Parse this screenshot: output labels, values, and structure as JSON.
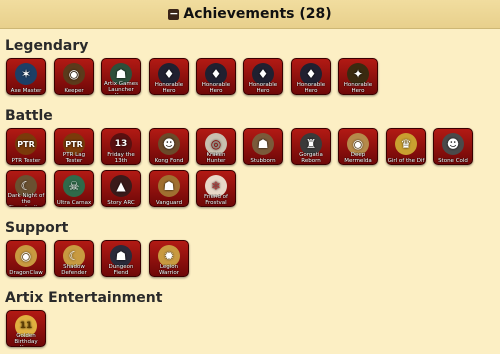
{
  "header": {
    "toggle": "−",
    "title": "Achievements (28)"
  },
  "sections": {
    "legendary": {
      "title": "Legendary"
    },
    "battle": {
      "title": "Battle"
    },
    "support": {
      "title": "Support"
    },
    "artix": {
      "title": "Artix Entertainment"
    }
  },
  "badges": {
    "b1": {
      "label": "Axe Master",
      "glyph": "✶"
    },
    "b2": {
      "label": "Keeper",
      "glyph": "◉"
    },
    "b3": {
      "label": "Artix Games Launcher Hero",
      "glyph": "☗"
    },
    "b4": {
      "label": "Honorable Hero",
      "glyph": "♦"
    },
    "b5": {
      "label": "Honorable Hero",
      "glyph": "♦"
    },
    "b6": {
      "label": "Honorable Hero",
      "glyph": "♦"
    },
    "b7": {
      "label": "Honorable Hero",
      "glyph": "♦"
    },
    "b8": {
      "label": "Honorable Hero",
      "glyph": "✦"
    },
    "b9": {
      "label": "PTR Tester",
      "glyph": "PTR"
    },
    "b10": {
      "label": "PTR Lag Tester",
      "glyph": "PTR"
    },
    "b11": {
      "label": "Friday the 13th",
      "glyph": "13"
    },
    "b12": {
      "label": "Kong Fond",
      "glyph": "☻"
    },
    "b13": {
      "label": "Kraken Hunter",
      "glyph": "◎"
    },
    "b14": {
      "label": "Stubborn",
      "glyph": "☗"
    },
    "b15": {
      "label": "Gorgatia Reborn",
      "glyph": "♜"
    },
    "b16": {
      "label": "Deep Mermelda",
      "glyph": "◉"
    },
    "b17": {
      "label": "Girl of the Dif",
      "glyph": "♛"
    },
    "b18": {
      "label": "Stone Cold",
      "glyph": "☻"
    },
    "b19": {
      "label": "Dark Night of the Disembodied",
      "glyph": "☾"
    },
    "b20": {
      "label": "Ultra Carnax",
      "glyph": "☠"
    },
    "b21": {
      "label": "Story ARC",
      "glyph": "▲"
    },
    "b22": {
      "label": "Vanguard",
      "glyph": "☗"
    },
    "b23": {
      "label": "Friend of Frostval",
      "glyph": "❄"
    },
    "b24": {
      "label": "DragonClaw",
      "glyph": "◉"
    },
    "b25": {
      "label": "Shadow Defender",
      "glyph": "☾"
    },
    "b26": {
      "label": "Dungeon Fiend",
      "glyph": "☗"
    },
    "b27": {
      "label": "Legion Warrior",
      "glyph": "✹"
    },
    "b28": {
      "label": "Golden Birthday Hero",
      "glyph": "11"
    }
  },
  "colors": {
    "background": "#fcefc4",
    "badge_red": "#b21a14"
  }
}
